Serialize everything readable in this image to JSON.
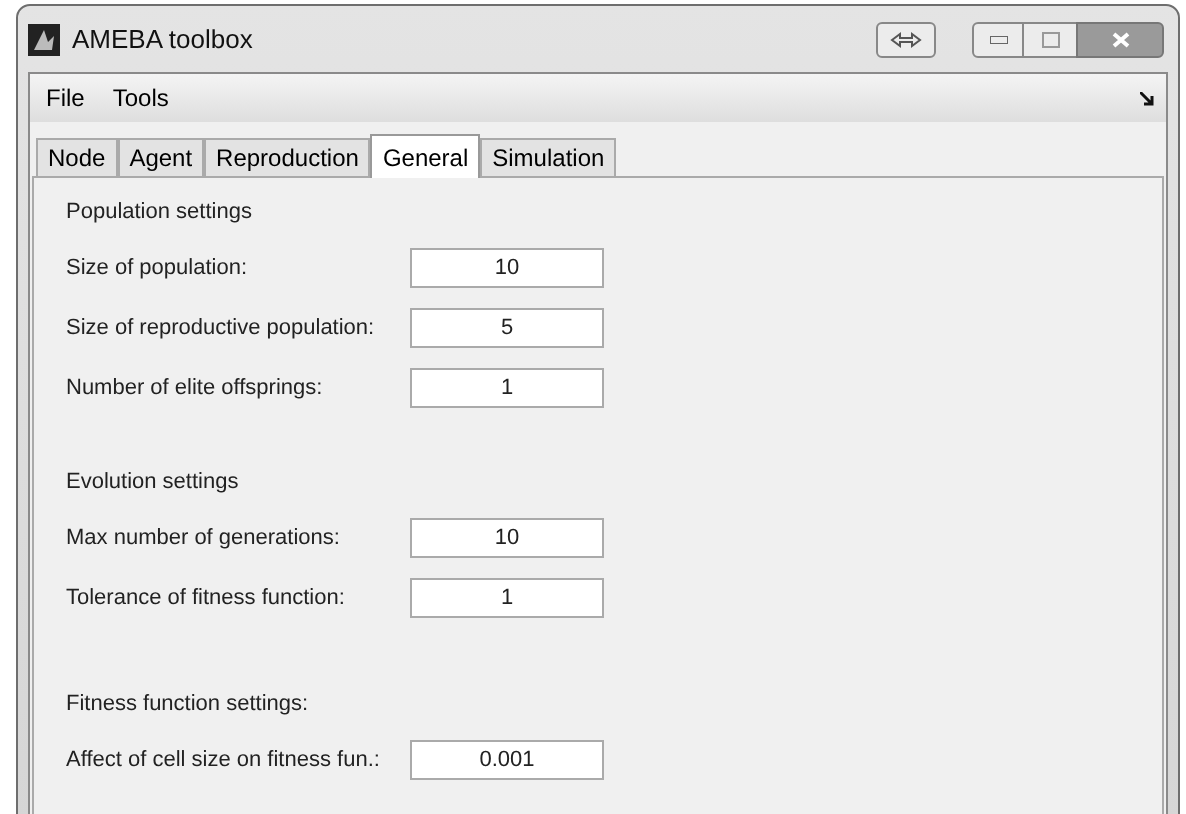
{
  "window": {
    "title": "AMEBA toolbox"
  },
  "menu": [
    "File",
    "Tools"
  ],
  "tabs": [
    {
      "label": "Node",
      "selected": false
    },
    {
      "label": "Agent",
      "selected": false
    },
    {
      "label": "Reproduction",
      "selected": false
    },
    {
      "label": "General",
      "selected": true
    },
    {
      "label": "Simulation",
      "selected": false
    }
  ],
  "sections": [
    {
      "title": "Population settings",
      "fields": [
        {
          "label": "Size of population:",
          "value": "10"
        },
        {
          "label": "Size of reproductive population:",
          "value": "5"
        },
        {
          "label": "Number of elite offsprings:",
          "value": "1"
        }
      ]
    },
    {
      "title": "Evolution settings",
      "fields": [
        {
          "label": "Max number of generations:",
          "value": "10"
        },
        {
          "label": "Tolerance of fitness function:",
          "value": "1"
        }
      ]
    },
    {
      "title": "Fitness function settings:",
      "fields": [
        {
          "label": "Affect of cell size on fitness fun.:",
          "value": "0.001"
        }
      ]
    }
  ]
}
